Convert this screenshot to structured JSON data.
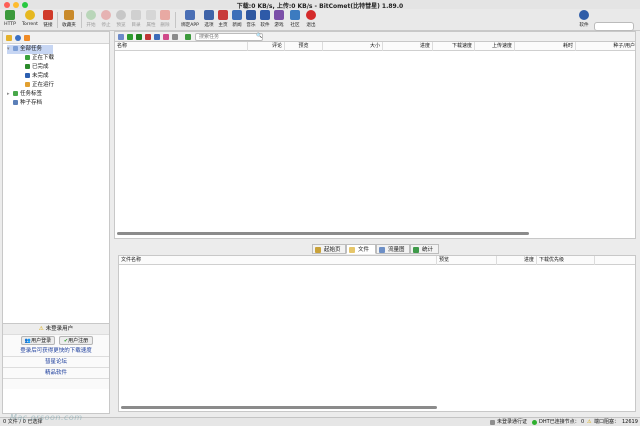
{
  "window": {
    "title": "下载:0 KB/s, 上传:0 KB/s - BitComet(比特彗星) 1.89.0"
  },
  "toolbar": {
    "buttons": [
      {
        "label": "HTTP"
      },
      {
        "label": "Torrent"
      },
      {
        "label": "链接"
      },
      {
        "label": "收藏夹"
      },
      {
        "label": "开始"
      },
      {
        "label": "停止"
      },
      {
        "label": "预览"
      },
      {
        "label": "目录"
      },
      {
        "label": "属性"
      },
      {
        "label": "删除"
      },
      {
        "label": "绑定APP"
      },
      {
        "label": "选项"
      },
      {
        "label": "主页"
      },
      {
        "label": "新闻"
      },
      {
        "label": "音乐"
      },
      {
        "label": "软件"
      },
      {
        "label": "游戏"
      },
      {
        "label": "社区"
      },
      {
        "label": "退出"
      }
    ],
    "right_label": "软件"
  },
  "sidebar": {
    "tree": [
      {
        "label": "全部任务"
      },
      {
        "label": "正在下载"
      },
      {
        "label": "已完成"
      },
      {
        "label": "未完成"
      },
      {
        "label": "正在运行"
      },
      {
        "label": "任务标签"
      },
      {
        "label": "种子存档"
      }
    ],
    "login": {
      "status": "未登录用户",
      "login_button": "用户登录",
      "register_button": "用户注册",
      "promo": "登录后可获得更快的下载速度",
      "forum": "彗星论坛",
      "software": "精品软件"
    }
  },
  "search": {
    "placeholder": "搜索任务"
  },
  "task_columns": [
    "名称",
    "评论",
    "预览",
    "大小",
    "进度",
    "下载速度",
    "上传速度",
    "耗时",
    "种子/用户"
  ],
  "tabs": [
    "起始页",
    "文件",
    "流量图",
    "统计"
  ],
  "file_columns": [
    "文件名称",
    "预览",
    "进度",
    "下载优先级"
  ],
  "statusbar": {
    "left": "0 文件 / 0 已选择",
    "user": "未登录通行证",
    "dht": "DHT已连接节点：",
    "dht_count": "0",
    "port": "端口阻塞：",
    "port_num": "12619"
  },
  "watermark": "Mac.orsoon.com"
}
